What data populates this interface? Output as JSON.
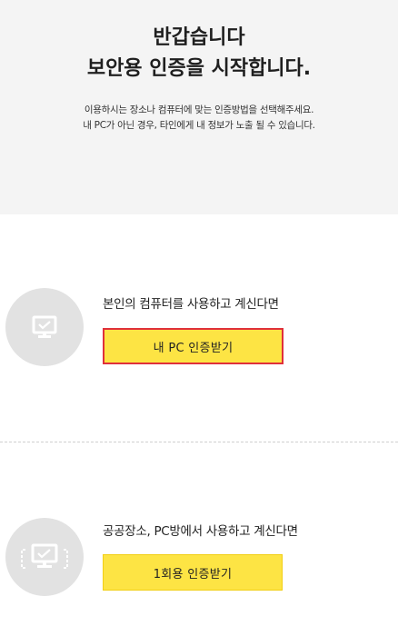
{
  "header": {
    "title_line1": "반갑습니다",
    "title_line2": "보안용 인증을 시작합니다.",
    "desc_line1": "이용하시는 장소나 컴퓨터에 맞는 인증방법을 선택해주세요.",
    "desc_line2": "내 PC가 아닌 경우, 타인에게 내 정보가 노출 될 수 있습니다."
  },
  "options": {
    "my_pc": {
      "icon": "monitor-icon",
      "text": "본인의 컴퓨터를 사용하고 계신다면",
      "button_label": "내 PC 인증받기"
    },
    "one_time": {
      "icon": "shared-monitor-icon",
      "text": "공공장소, PC방에서 사용하고 계신다면",
      "button_label": "1회용 인증받기"
    }
  },
  "colors": {
    "button_bg": "#fde444",
    "highlight_border": "#e0303a",
    "header_bg": "#f4f4f4",
    "icon_circle": "#e2e2e2"
  }
}
